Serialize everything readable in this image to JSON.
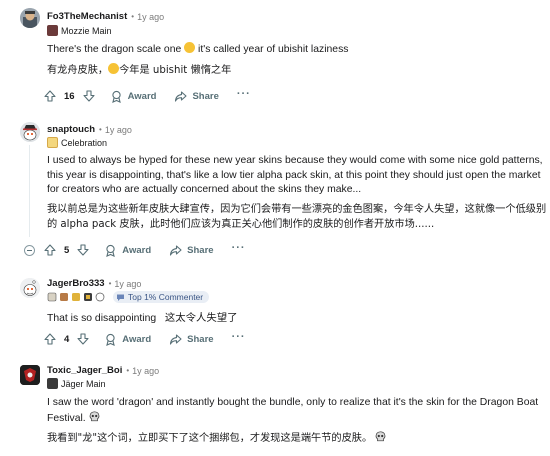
{
  "comments": [
    {
      "user": "Fo3TheMechanist",
      "age": "1y ago",
      "flair": "Mozzie Main",
      "paragraphs": [
        {
          "text": "There's the dragon scale one",
          "emoji": "face",
          "after": " it's called year of ubishit laziness"
        },
        {
          "text": "有龙舟皮肤，",
          "emoji": "face",
          "after": "今年是 ubishit 懒惰之年"
        }
      ],
      "votes": "16",
      "award_label": "Award",
      "share_label": "Share",
      "more_label": "···"
    },
    {
      "user": "snaptouch",
      "age": "1y ago",
      "flair": "Celebration",
      "paragraphs": [
        {
          "text": "I used to always be hyped for these new year skins because they would come with some nice gold patterns, this year is disappointing, that's like a low tier alpha pack skin, at this point they should just open the market for creators who are actually concerned about the skins they make..."
        },
        {
          "text": "我以前总是为这些新年皮肤大肆宣传，因为它们会带有一些漂亮的金色图案，今年令人失望，这就像一个低级别的 alpha pack 皮肤，此时他们应该为真正关心他们制作的皮肤的创作者开放市场......"
        }
      ],
      "votes": "5",
      "award_label": "Award",
      "share_label": "Share",
      "more_label": "···"
    },
    {
      "user": "JagerBro333",
      "age": "1y ago",
      "pill": "Top 1% Commenter",
      "paragraphs": [
        {
          "text": "That is so disappointing   这太令人失望了"
        }
      ],
      "votes": "4",
      "award_label": "Award",
      "share_label": "Share",
      "more_label": "···"
    },
    {
      "user": "Toxic_Jager_Boi",
      "age": "1y ago",
      "flair": "Jäger Main",
      "paragraphs": [
        {
          "text": "I saw the word 'dragon' and instantly bought the bundle, only to realize that it's the skin for the Dragon Boat Festival.",
          "emoji": "skull"
        },
        {
          "text": "我看到\"龙\"这个词，立即买下了这个捆绑包，才发现这是端午节的皮肤。",
          "emoji": "skull"
        }
      ]
    }
  ],
  "colors": {
    "text": "#1a1a1b",
    "meta": "#7c7c7c",
    "action": "#576f76",
    "pill_bg": "#e9eef5",
    "pill_text": "#3a5585"
  }
}
